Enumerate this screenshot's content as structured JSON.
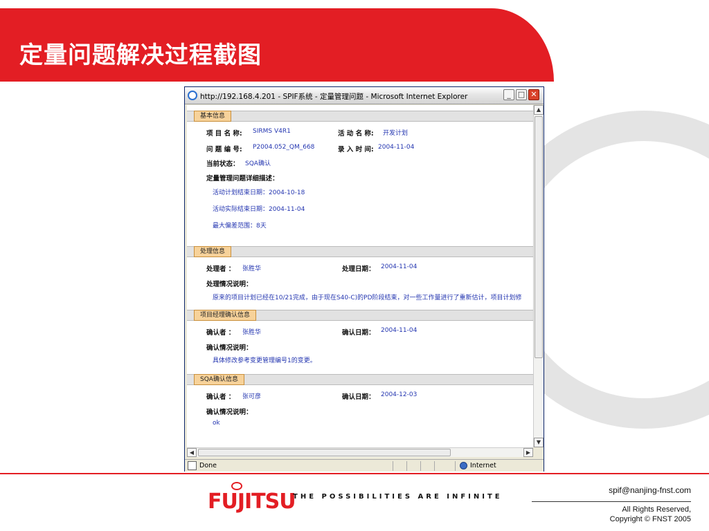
{
  "slide": {
    "title": "定量问题解决过程截图"
  },
  "browser": {
    "window_title": "http://192.168.4.201 - SPIF系统 - 定量管理问题 - Microsoft Internet Explorer",
    "status": "Done",
    "zone": "Internet",
    "min_symbol": "_",
    "max_symbol": "□",
    "close_symbol": "✕"
  },
  "basic_info": {
    "section_label": "基本信息",
    "project_name_label": "项 目 名 称:",
    "project_name": "SIRMS V4R1",
    "activity_name_label": "活 动 名 称:",
    "activity_name": "开发计划",
    "issue_no_label": "问 题 编 号:",
    "issue_no": "P2004.052_QM_668",
    "entry_time_label": "录 入 时 间:",
    "entry_time": "2004-11-04",
    "status_label": "当前状态：",
    "status": "SQA确认",
    "detail_label": "定量管理问题详细描述：",
    "detail_lines": [
      "活动计划结束日期：2004-10-18",
      "活动实际结束日期：2004-11-04",
      "最大偏差范围：8天"
    ]
  },
  "processing_info": {
    "section_label": "处理信息",
    "handler_label": "处理者 ：",
    "handler": "张胜华",
    "date_label": "处理日期：",
    "date": "2004-11-04",
    "note_label": "处理情况说明：",
    "note": "原来的项目计划已经在10/21完成，由于现在S40-C)的PD阶段结束，对一些工作量进行了重新估计，项目计划修"
  },
  "pm_confirm": {
    "section_label": "项目经理确认信息",
    "confirmer_label": "确认者 ：",
    "confirmer": "张胜华",
    "date_label": "确认日期：",
    "date": "2004-11-04",
    "note_label": "确认情况说明：",
    "note": "具体修改参考变更管理编号1的变更。"
  },
  "sqa_confirm": {
    "section_label": "SQA确认信息",
    "confirmer_label": "确认者 ：",
    "confirmer": "张可彦",
    "date_label": "确认日期：",
    "date": "2004-12-03",
    "note_label": "确认情况说明：",
    "note": "ok"
  },
  "footer": {
    "logo": "FUJITSU",
    "tagline": "THE POSSIBILITIES ARE INFINITE",
    "email": "spif@nanjing-fnst.com",
    "rights": "All Rights Reserved,",
    "copyright": "Copyright © FNST 2005"
  },
  "colors": {
    "brand_red": "#e31e24",
    "link_blue": "#2335b0",
    "section_tab": "#f7d29a"
  }
}
